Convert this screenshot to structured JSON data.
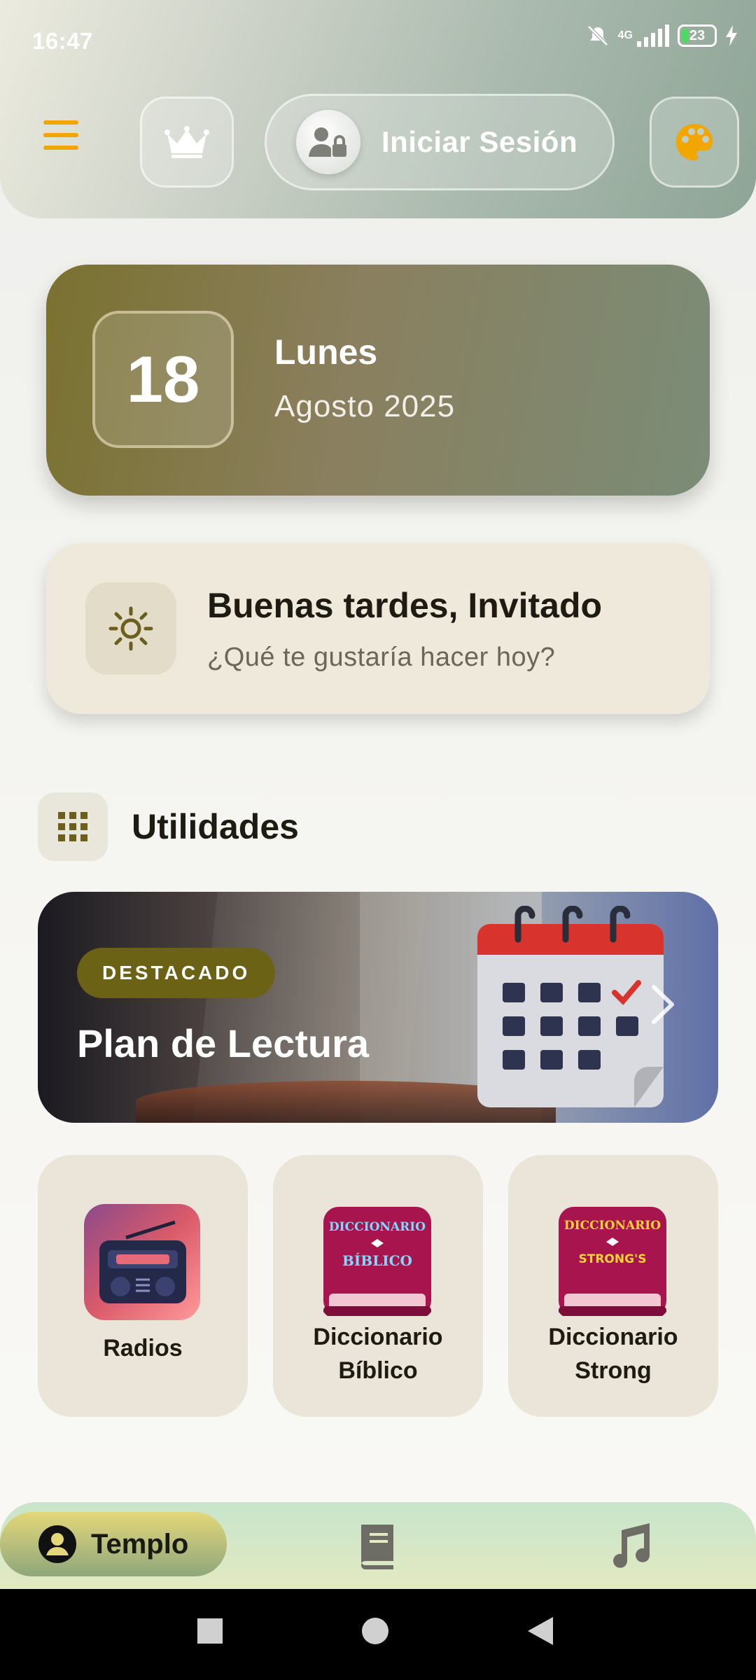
{
  "status_bar": {
    "time": "16:47",
    "network": "4G",
    "battery": "23"
  },
  "header": {
    "menu_icon": "hamburger-icon",
    "premium_icon": "crown-icon",
    "login_label": "Iniciar Sesión",
    "theme_icon": "palette-icon",
    "accent_color": "#f2a600"
  },
  "date_card": {
    "day": "18",
    "weekday": "Lunes",
    "month_year": "Agosto 2025"
  },
  "greeting": {
    "title": "Buenas tardes, Invitado",
    "subtitle": "¿Qué te gustaría hacer hoy?",
    "icon": "sun-icon"
  },
  "utilities": {
    "title": "Utilidades",
    "icon": "grid-icon",
    "featured": {
      "badge": "DESTACADO",
      "title": "Plan de Lectura"
    },
    "tiles": [
      {
        "label": "Radios",
        "icon": "radio-icon"
      },
      {
        "label": "Diccionario Bíblico",
        "icon": "bible-dictionary-icon",
        "art_text": [
          "DICCIONARIO",
          "BÍBLICO"
        ]
      },
      {
        "label": "Diccionario Strong",
        "icon": "strong-dictionary-icon",
        "art_text": [
          "DICCIONARIO",
          "STRONG'S"
        ]
      }
    ]
  },
  "bottom_nav": {
    "items": [
      {
        "label": "Templo",
        "icon": "person-icon",
        "active": true
      },
      {
        "label": "",
        "icon": "book-icon",
        "active": false
      },
      {
        "label": "",
        "icon": "music-icon",
        "active": false
      }
    ]
  }
}
